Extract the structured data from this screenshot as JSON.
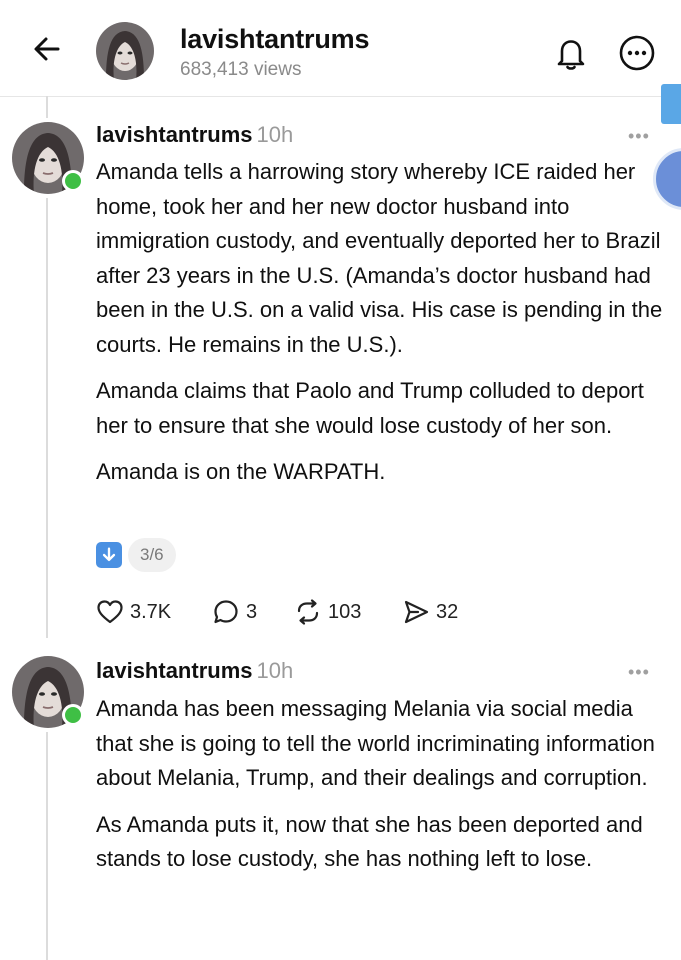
{
  "header": {
    "username": "lavishtantrums",
    "views": "683,413 views",
    "icons": [
      "back-arrow-icon",
      "bell-icon",
      "more-options-icon"
    ]
  },
  "posts": [
    {
      "username": "lavishtantrums",
      "time": "10h",
      "more": "•••",
      "paragraphs": [
        "Amanda tells a harrowing story whereby ICE raided her home, took her and her new doctor husband into immigration custody, and eventually deported her to Brazil after 23 years in the U.S. (Amanda’s doctor husband had been in the U.S. on a valid visa. His case is pending in the courts. He remains in the U.S.).",
        "Amanda claims that Paolo and Trump colluded to deport her to ensure that she would lose custody of her son.",
        "Amanda is on the WARPATH."
      ],
      "thread_position": "3/6",
      "actions": {
        "likes": "3.7K",
        "replies": "3",
        "reposts": "103",
        "shares": "32"
      }
    },
    {
      "username": "lavishtantrums",
      "time": "10h",
      "more": "•••",
      "paragraphs": [
        "Amanda has been messaging Melania via social media that she is going to tell the world incriminating information about Melania, Trump, and their dealings and corruption.",
        "As Amanda puts it, now that she has been deported and stands to lose custody, she has nothing left to lose."
      ]
    }
  ],
  "colors": {
    "online": "#3fbf45",
    "divider": "#e6e6e6",
    "muted_text": "#9a9a9a",
    "badge_blue": "#4a90e2"
  }
}
